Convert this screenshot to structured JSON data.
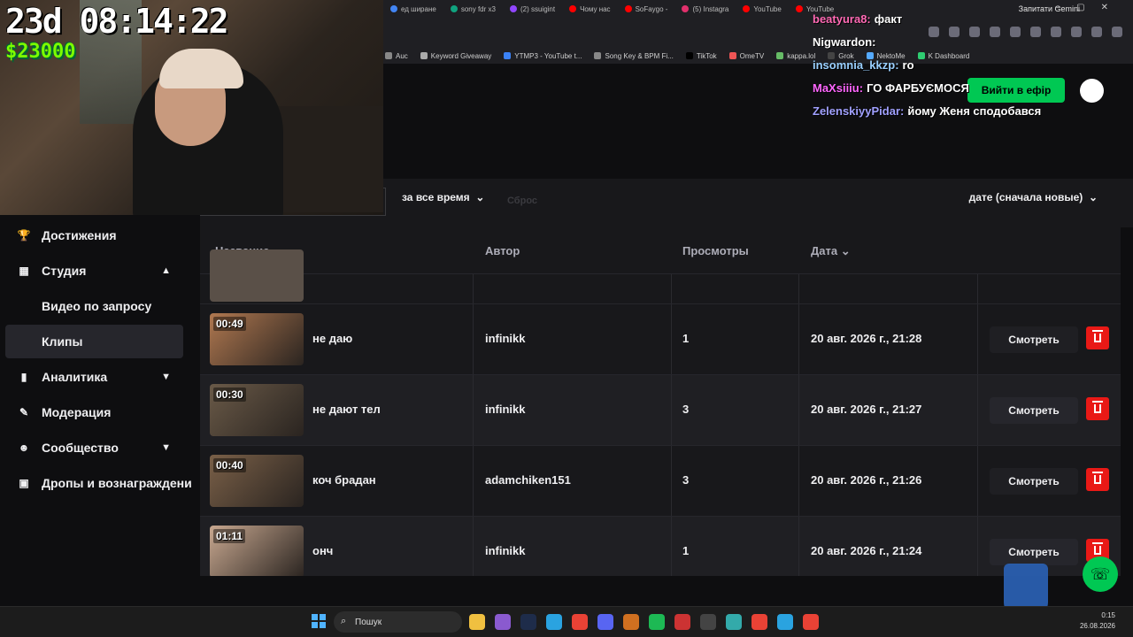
{
  "overlay": {
    "timer": "23d 08:14:22",
    "money": "$23000"
  },
  "browser": {
    "tabs": [
      {
        "label": "ед ширане",
        "color": "#4285f4"
      },
      {
        "label": "sony fdr x3",
        "color": "#10a37f"
      },
      {
        "label": "(2) ssuigint",
        "color": "#9146ff"
      },
      {
        "label": "Чому нас",
        "color": "#ff0000"
      },
      {
        "label": "SoFaygo -",
        "color": "#ff0000"
      },
      {
        "label": "(5) Instagra",
        "color": "#e1306c"
      },
      {
        "label": "YouTube",
        "color": "#ff0000"
      },
      {
        "label": "YouTube",
        "color": "#ff0000"
      }
    ],
    "gemini_label": "Запитати Gemini",
    "bookmarks": [
      {
        "label": "Auc",
        "color": "#888"
      },
      {
        "label": "Keyword Giveaway",
        "color": "#aaa"
      },
      {
        "label": "YTMP3 - YouTube t...",
        "color": "#3b82f6"
      },
      {
        "label": "Song Key & BPM Fi...",
        "color": "#888"
      },
      {
        "label": "TikTok",
        "color": "#000"
      },
      {
        "label": "OmeTV",
        "color": "#e55"
      },
      {
        "label": "kappa.lol",
        "color": "#6b6"
      },
      {
        "label": "Grok",
        "color": "#444"
      },
      {
        "label": "NektoMe",
        "color": "#5af"
      },
      {
        "label": "K Dashboard",
        "color": "#2ecc71"
      }
    ],
    "live_button": "Вийти в ефір"
  },
  "chat": [
    {
      "user": "beatyura8:",
      "color": "#ff69b4",
      "msg": "факт"
    },
    {
      "user": "Nigwardon:",
      "color": "#ffffff",
      "msg": ""
    },
    {
      "user": "insomnia_kkzp:",
      "color": "#9ad0ff",
      "msg": "ro"
    },
    {
      "user": "MaXsiiiu:",
      "color": "#ff66ff",
      "msg": "ГО ФАРБУЄМОСЯ"
    },
    {
      "user": "ZelenskiyyPidar:",
      "color": "#a0a0ff",
      "msg": "йому Женя сподобався"
    }
  ],
  "sidebar": {
    "items": [
      {
        "label": "Достижения",
        "icon": "trophy-icon",
        "glyph": "🏆",
        "chevron": ""
      },
      {
        "label": "Студия",
        "icon": "film-icon",
        "glyph": "▦",
        "chevron": "▲"
      },
      {
        "label": "Видео по запросу",
        "icon": "",
        "glyph": "",
        "chevron": ""
      },
      {
        "label": "Клипы",
        "icon": "",
        "glyph": "",
        "chevron": ""
      },
      {
        "label": "Аналитика",
        "icon": "chart-icon",
        "glyph": "▮",
        "chevron": "▼"
      },
      {
        "label": "Модерация",
        "icon": "wrench-icon",
        "glyph": "✎",
        "chevron": ""
      },
      {
        "label": "Сообщество",
        "icon": "people-icon",
        "glyph": "☻",
        "chevron": "▼"
      },
      {
        "label": "Дропы и вознаграждени",
        "icon": "gift-icon",
        "glyph": "▣",
        "chevron": ""
      }
    ]
  },
  "filters": {
    "period": "за все время",
    "reset": "Сброс",
    "sort": "дате (сначала новые)"
  },
  "table": {
    "headers": {
      "name": "Название",
      "author": "Автор",
      "views": "Просмотры",
      "date": "Дата"
    },
    "watch_label": "Смотреть",
    "rows": [
      {
        "duration": "00:49",
        "title": "не даю",
        "author": "infinikk",
        "views": "1",
        "date": "20 авг. 2026 г., 21:28",
        "thumb": "#b07850"
      },
      {
        "duration": "00:30",
        "title": "не дают тел",
        "author": "infinikk",
        "views": "3",
        "date": "20 авг. 2026 г., 21:27",
        "thumb": "#6a5a48"
      },
      {
        "duration": "00:40",
        "title": "коч брадан",
        "author": "adamchiken151",
        "views": "3",
        "date": "20 авг. 2026 г., 21:26",
        "thumb": "#7a6048"
      },
      {
        "duration": "01:11",
        "title": "онч",
        "author": "infinikk",
        "views": "1",
        "date": "20 авг. 2026 г., 21:24",
        "thumb": "#c8a890"
      }
    ]
  },
  "taskbar": {
    "search_placeholder": "Пошук",
    "time": "0:15",
    "date": "26.08.2026"
  }
}
